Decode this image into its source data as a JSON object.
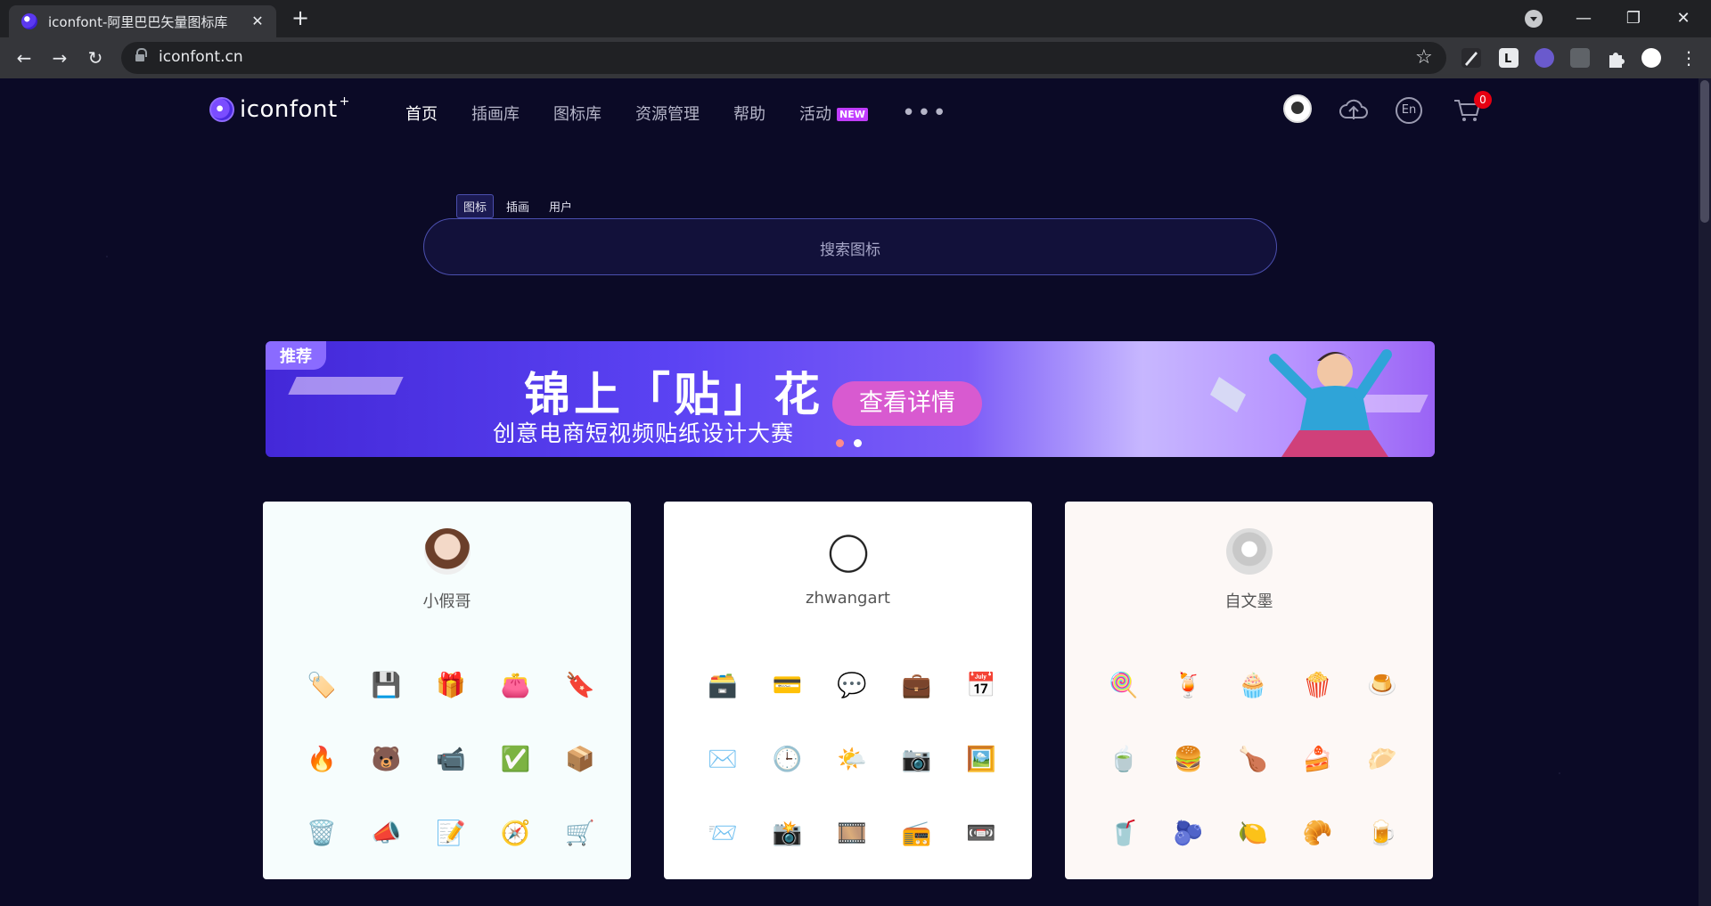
{
  "browser": {
    "tab_title": "iconfont-阿里巴巴矢量图标库",
    "tab_close": "✕",
    "new_tab": "+",
    "url": "iconfont.cn",
    "back": "←",
    "forward": "→",
    "reload": "↻",
    "star": "☆",
    "minimize": "—",
    "maximize": "❐",
    "close": "✕",
    "menu": "⋮"
  },
  "header": {
    "logo_text": "iconfont",
    "logo_plus": "+",
    "nav": [
      {
        "label": "首页",
        "active": true
      },
      {
        "label": "插画库"
      },
      {
        "label": "图标库"
      },
      {
        "label": "资源管理"
      },
      {
        "label": "帮助"
      },
      {
        "label": "活动",
        "badge": "NEW"
      }
    ],
    "more": "•••",
    "lang_button": "En",
    "cart_count": "0",
    "upload_icon": "☁",
    "cart_icon": "🛒"
  },
  "search": {
    "tabs": [
      "图标",
      "插画",
      "用户"
    ],
    "placeholder": "搜索图标"
  },
  "banner": {
    "tag": "推荐",
    "title": "锦上「贴」花",
    "subtitle": "创意电商短视频贴纸设计大赛",
    "cta": "查看详情"
  },
  "cards": [
    {
      "name": "小假哥",
      "bg": "#f6fdfd",
      "icons": [
        "🏷️",
        "💾",
        "🎁",
        "👛",
        "🔖",
        "🔥",
        "🐻",
        "📹",
        "✅",
        "📦",
        "🗑️",
        "📣",
        "📝",
        "🧭",
        "🛒"
      ]
    },
    {
      "name": "zhwangart",
      "bg": "#ffffff",
      "icons": [
        "🗃️",
        "💳",
        "💬",
        "💼",
        "📅",
        "✉️",
        "🕒",
        "🌤️",
        "📷",
        "🖼️",
        "📨",
        "📸",
        "🎞️",
        "📻",
        "📼"
      ]
    },
    {
      "name": "自文墨",
      "bg": "#fdf8f6",
      "icons": [
        "🍭",
        "🍹",
        "🧁",
        "🍿",
        "🍮",
        "🍵",
        "🍔",
        "🍗",
        "🍰",
        "🥟",
        "🥤",
        "🫐",
        "🍋",
        "🥐",
        "🍺"
      ]
    }
  ],
  "colors": {
    "page_bg": "#0b0a26",
    "accent": "#5b39f0",
    "badge_new": "#c13dff",
    "cart_badge": "#e60012"
  }
}
